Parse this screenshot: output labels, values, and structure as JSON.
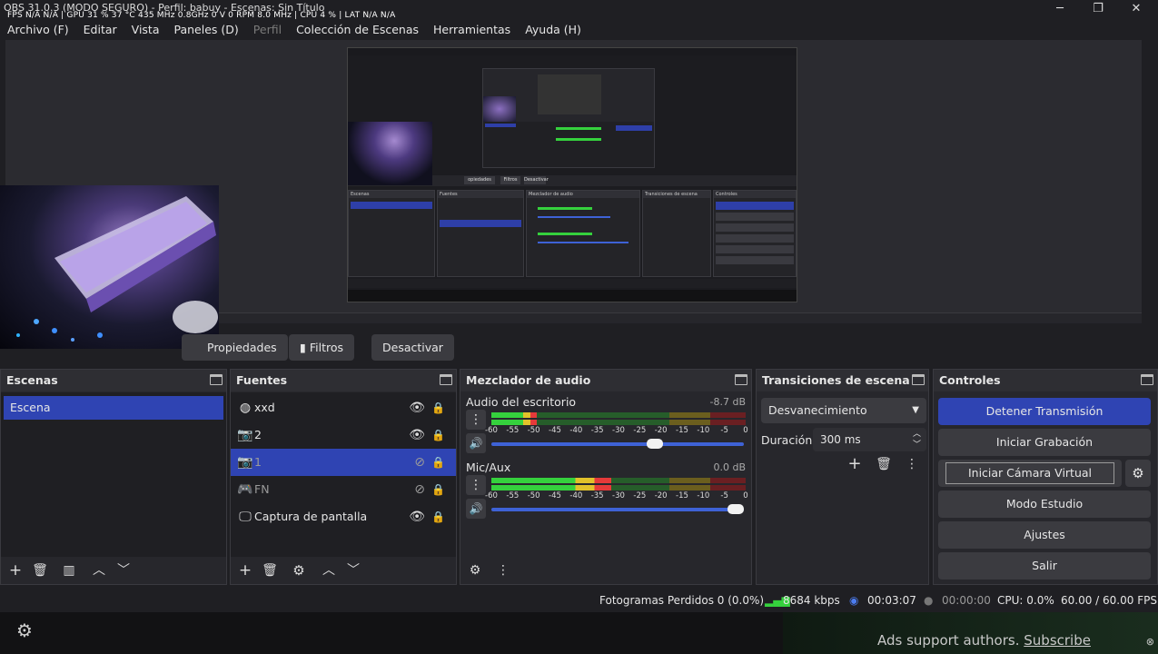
{
  "window": {
    "title": "OBS 31.0.3 (MODO SEGURO) - Perfil: babuy - Escenas: Sin Título",
    "stats_overlay": "FPS N/A N/A | GPU 31 % 37 °C 435 MHz 0.8GHz 0 V 0 RPM 8.0 MHz | CPU 4 % | LAT N/A N/A",
    "minimize": "─",
    "maximize": "❐",
    "close": "✕"
  },
  "menu": [
    "Archivo (F)",
    "Editar",
    "Vista",
    "Paneles (D)",
    "Perfil",
    "Colección de Escenas",
    "Herramientas",
    "Ayuda (H)"
  ],
  "toolbar": {
    "properties_label": "Propiedades",
    "filters_label": "Filtros",
    "deactivate_label": "Desactivar"
  },
  "scenes": {
    "title": "Escenas",
    "items": [
      "Escena"
    ]
  },
  "sources": {
    "title": "Fuentes",
    "items": [
      {
        "name": "xxd",
        "icon": "browser-icon",
        "visible": true,
        "selected": false
      },
      {
        "name": "2",
        "icon": "camera-icon",
        "visible": true,
        "selected": false
      },
      {
        "name": "1",
        "icon": "camera-icon",
        "visible": false,
        "selected": true
      },
      {
        "name": "FN",
        "icon": "gamepad-icon",
        "visible": false,
        "selected": false
      },
      {
        "name": "Captura de pantalla",
        "icon": "monitor-icon",
        "visible": true,
        "selected": false
      }
    ]
  },
  "mixer": {
    "title": "Mezclador de audio",
    "ticks": [
      "-60",
      "-55",
      "-50",
      "-45",
      "-40",
      "-35",
      "-30",
      "-25",
      "-20",
      "-15",
      "-10",
      "-5",
      "0"
    ],
    "channels": [
      {
        "name": "Audio del escritorio",
        "db": "-8.7 dB",
        "level": 0.18,
        "volume": 0.68
      },
      {
        "name": "Mic/Aux",
        "db": "0.0 dB",
        "level": 0.47,
        "volume": 1.0
      }
    ]
  },
  "transitions": {
    "title": "Transiciones de escena",
    "selected": "Desvanecimiento",
    "duration_label": "Duración",
    "duration_value": "300 ms"
  },
  "controls": {
    "title": "Controles",
    "stop_stream": "Detener Transmisión",
    "start_record": "Iniciar Grabación",
    "start_virtualcam": "Iniciar Cámara Virtual",
    "studio_mode": "Modo Estudio",
    "settings": "Ajustes",
    "exit": "Salir"
  },
  "status": {
    "dropped_frames": "Fotogramas Perdidos 0 (0.0%)",
    "bitrate": "8684 kbps",
    "stream_time": "00:03:07",
    "record_time": "00:00:00",
    "cpu": "CPU: 0.0%",
    "fps": "60.00 / 60.00 FPS"
  },
  "ad": {
    "text": "Ads support authors.",
    "link": "Subscribe"
  },
  "colors": {
    "accent": "#2f44b3",
    "meter_green": "#35d13d",
    "meter_yellow": "#e2c22a",
    "meter_red": "#e63a3a",
    "bitrate_green": "#35d13d"
  }
}
